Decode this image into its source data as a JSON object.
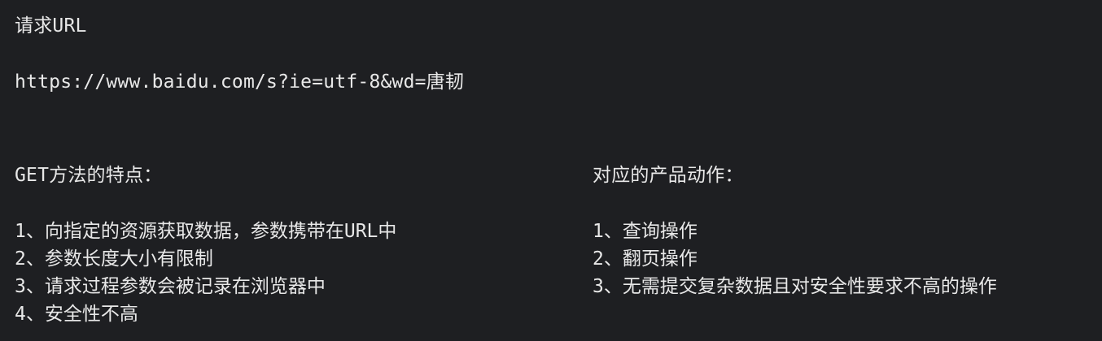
{
  "request": {
    "heading": "请求URL",
    "url": "https://www.baidu.com/s?ie=utf-8&wd=唐韧"
  },
  "get_features": {
    "title": "GET方法的特点：",
    "items": [
      "1、向指定的资源获取数据，参数携带在URL中",
      "2、参数长度大小有限制",
      "3、请求过程参数会被记录在浏览器中",
      "4、安全性不高"
    ]
  },
  "product_actions": {
    "title": "对应的产品动作：",
    "items": [
      "1、查询操作",
      "2、翻页操作",
      "3、无需提交复杂数据且对安全性要求不高的操作"
    ]
  },
  "colors": {
    "background": "#1e1f22",
    "text": "#e8e8e8"
  }
}
